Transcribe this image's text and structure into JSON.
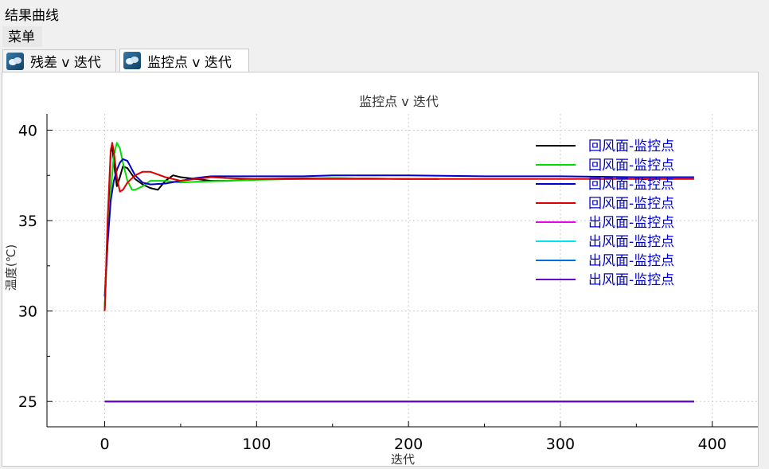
{
  "window": {
    "title": "结果曲线"
  },
  "menu": {
    "items": [
      "菜单"
    ]
  },
  "tabs": [
    {
      "label": "残差 v 迭代",
      "active": false
    },
    {
      "label": "监控点 v 迭代",
      "active": true
    }
  ],
  "chart_data": {
    "type": "line",
    "title": "监控点 v 迭代",
    "xlabel": "迭代",
    "ylabel": "温度(℃)",
    "xlim": [
      -38,
      430
    ],
    "ylim": [
      23.6,
      40.9
    ],
    "xticks": [
      0,
      100,
      200,
      300,
      400
    ],
    "yticks": [
      25,
      30,
      35,
      40
    ],
    "grid": true,
    "legend_position": "top-right",
    "series": [
      {
        "name": "回风面-监控点",
        "color": "#000000",
        "x": [
          0,
          2,
          4,
          5,
          6,
          8,
          10,
          12,
          15,
          20,
          25,
          30,
          35,
          40,
          45,
          50,
          60,
          70,
          80,
          100,
          150,
          200,
          220
        ],
        "y": [
          30.0,
          34.5,
          38.8,
          39.1,
          38.2,
          36.9,
          37.4,
          38.0,
          37.9,
          37.3,
          37.0,
          36.8,
          36.7,
          37.2,
          37.5,
          37.4,
          37.3,
          37.2,
          37.2,
          37.3,
          37.35,
          37.3,
          37.3
        ]
      },
      {
        "name": "回风面-监控点",
        "color": "#00dd00",
        "x": [
          0,
          2,
          4,
          6,
          8,
          10,
          12,
          15,
          18,
          20,
          25,
          30,
          40,
          50,
          60,
          80,
          100,
          150,
          200,
          220
        ],
        "y": [
          30.2,
          34.0,
          36.6,
          38.6,
          39.3,
          39.0,
          38.2,
          37.2,
          36.7,
          36.7,
          36.9,
          37.2,
          37.2,
          37.1,
          37.15,
          37.2,
          37.25,
          37.35,
          37.3,
          37.3
        ]
      },
      {
        "name": "回风面-监控点",
        "color": "#0000cc",
        "x": [
          0,
          2,
          4,
          6,
          8,
          10,
          12,
          15,
          20,
          25,
          30,
          40,
          50,
          60,
          70,
          100,
          130,
          150,
          200,
          250,
          300,
          350,
          388
        ],
        "y": [
          30.8,
          33.8,
          36.1,
          37.2,
          37.8,
          38.2,
          38.4,
          38.3,
          37.5,
          37.1,
          37.0,
          37.05,
          37.2,
          37.35,
          37.45,
          37.45,
          37.45,
          37.5,
          37.5,
          37.45,
          37.45,
          37.4,
          37.4
        ]
      },
      {
        "name": "回风面-监控点",
        "color": "#dd0000",
        "x": [
          0,
          2,
          4,
          5,
          6,
          8,
          10,
          12,
          15,
          20,
          25,
          30,
          40,
          50,
          60,
          70,
          80,
          100,
          200,
          300,
          388
        ],
        "y": [
          30.0,
          35.2,
          38.9,
          39.3,
          38.8,
          37.4,
          36.6,
          36.7,
          37.1,
          37.5,
          37.7,
          37.7,
          37.4,
          37.2,
          37.3,
          37.4,
          37.35,
          37.3,
          37.3,
          37.3,
          37.3
        ]
      },
      {
        "name": "出风面-监控点",
        "color": "#ee00ee",
        "x": [
          0,
          388
        ],
        "y": [
          25.0,
          25.0
        ]
      },
      {
        "name": "出风面-监控点",
        "color": "#00e5ee",
        "x": [
          0,
          388
        ],
        "y": [
          25.0,
          25.0
        ]
      },
      {
        "name": "出风面-监控点",
        "color": "#0070dd",
        "x": [
          0,
          388
        ],
        "y": [
          25.0,
          25.0
        ]
      },
      {
        "name": "出风面-监控点",
        "color": "#6600cc",
        "x": [
          0,
          388
        ],
        "y": [
          25.0,
          25.0
        ]
      }
    ]
  }
}
